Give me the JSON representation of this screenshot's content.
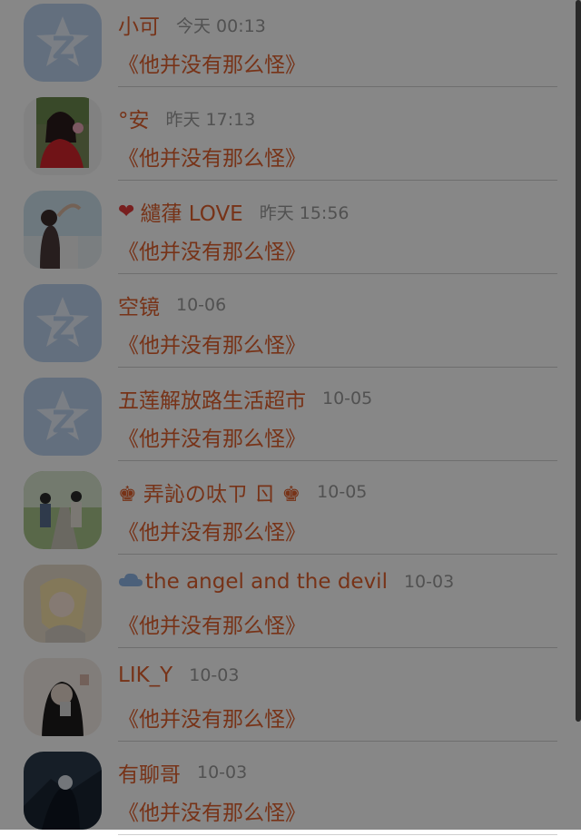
{
  "conversations": [
    {
      "name": "小可",
      "time": "今天 00:13",
      "message": "《他并没有那么怪》",
      "avatar": "default-qzone-star-icon",
      "prefix": ""
    },
    {
      "name": "°安",
      "time": "昨天 17:13",
      "message": "《他并没有那么怪》",
      "avatar": "user-photo-avatar",
      "prefix": ""
    },
    {
      "name": "繾葎 LOVE",
      "time": "昨天 15:56",
      "message": "《他并没有那么怪》",
      "avatar": "user-photo-avatar",
      "prefix": "heart-icon"
    },
    {
      "name": "空镜",
      "time": "10-06",
      "message": "《他并没有那么怪》",
      "avatar": "default-qzone-star-icon",
      "prefix": ""
    },
    {
      "name": "五莲解放路生活超市",
      "time": "10-05",
      "message": "《他并没有那么怪》",
      "avatar": "default-qzone-star-icon",
      "prefix": ""
    },
    {
      "name": "♚ 弄訫の呔ㄗ ㄖ ♚",
      "time": "10-05",
      "message": "《他并没有那么怪》",
      "avatar": "user-photo-avatar",
      "prefix": ""
    },
    {
      "name": "the angel and the devil",
      "time": "10-03",
      "message": "《他并没有那么怪》",
      "avatar": "user-photo-avatar",
      "prefix": "cloud-icon"
    },
    {
      "name": "LIK_Y",
      "time": "10-03",
      "message": "《他并没有那么怪》",
      "avatar": "user-photo-avatar",
      "prefix": ""
    },
    {
      "name": "有聊哥",
      "time": "10-03",
      "message": "《他并没有那么怪》",
      "avatar": "user-photo-avatar",
      "prefix": ""
    }
  ],
  "colors": {
    "name_text": "#e0612e",
    "message_text": "#e0612e",
    "time_text": "#9a9a9a",
    "heart": "#e23b3b",
    "default_avatar_bg": "#bcd2ef",
    "overlay": "rgba(0,0,0,0.47)"
  }
}
